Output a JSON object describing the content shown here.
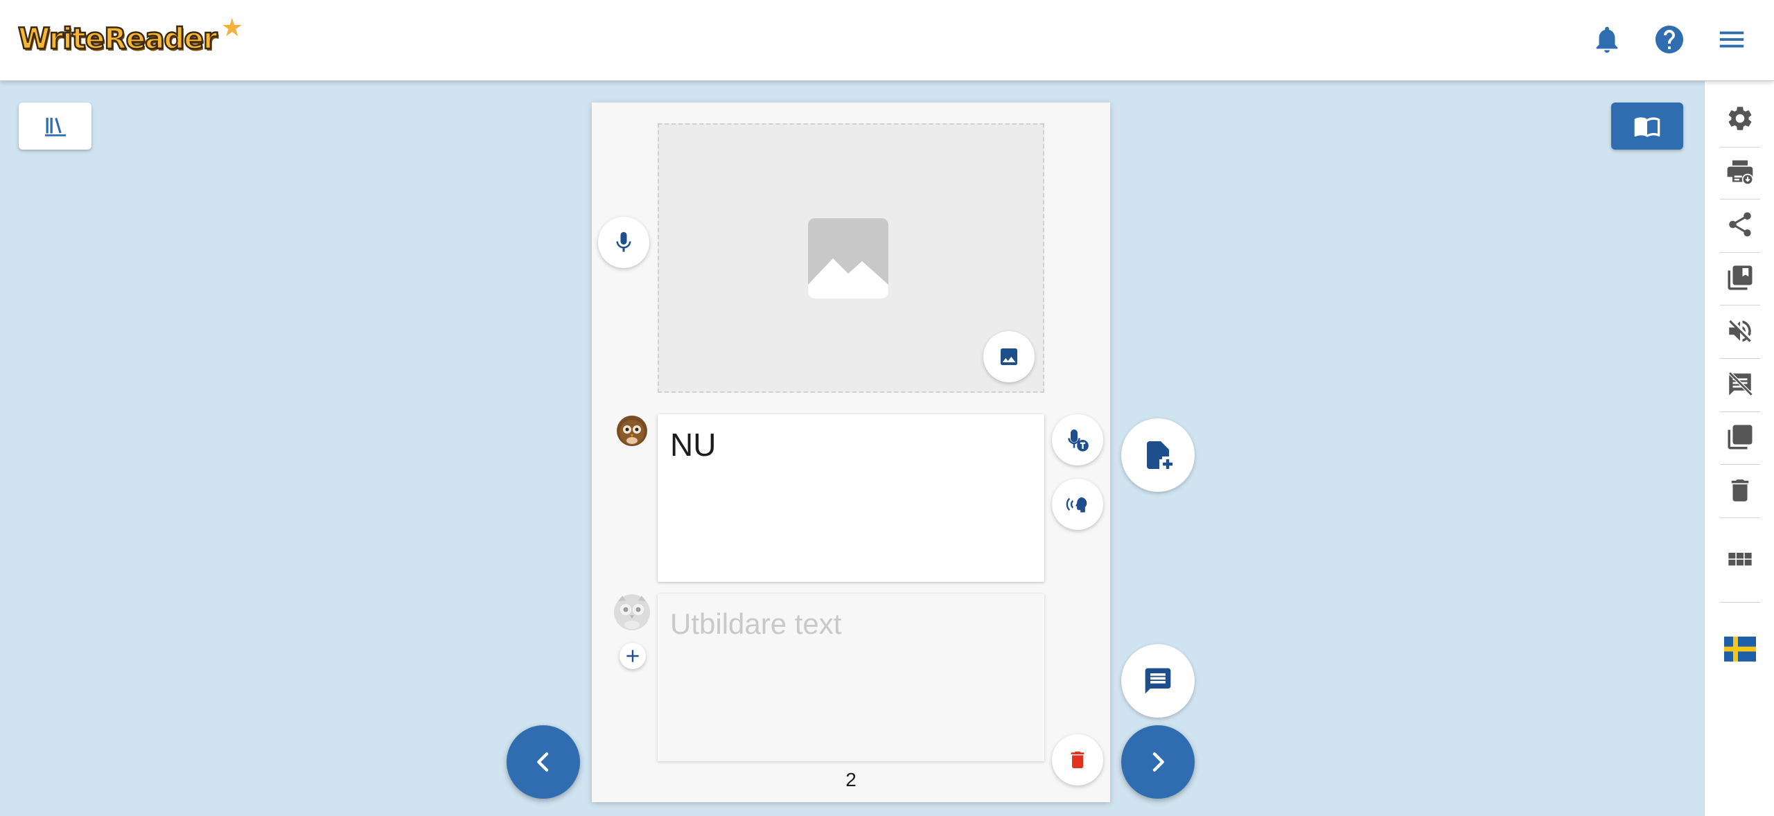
{
  "app": {
    "logo_text": "WriteReader",
    "logo_star": "★"
  },
  "header": {
    "icons": [
      "bell-icon",
      "help-icon",
      "menu-icon"
    ]
  },
  "sidebar": {
    "items": [
      {
        "name": "settings",
        "icon": "gear-icon"
      },
      {
        "name": "print",
        "icon": "printer-download-icon"
      },
      {
        "name": "share",
        "icon": "share-icon"
      },
      {
        "name": "library-copy",
        "icon": "library-icon"
      },
      {
        "name": "mute",
        "icon": "volume-off-icon"
      },
      {
        "name": "hide-text",
        "icon": "comment-off-icon"
      },
      {
        "name": "copy-page",
        "icon": "copy-icon"
      },
      {
        "name": "delete-book",
        "icon": "trash-icon"
      },
      {
        "name": "grid-view",
        "icon": "grid-icon"
      },
      {
        "name": "language",
        "icon": "swedish-flag-icon"
      }
    ]
  },
  "page": {
    "child_text": "NU",
    "educator_placeholder": "Utbildare text",
    "page_number": "2"
  },
  "colors": {
    "accent": "#2f6db0",
    "background": "#d0e3f0",
    "danger": "#e0321c"
  }
}
